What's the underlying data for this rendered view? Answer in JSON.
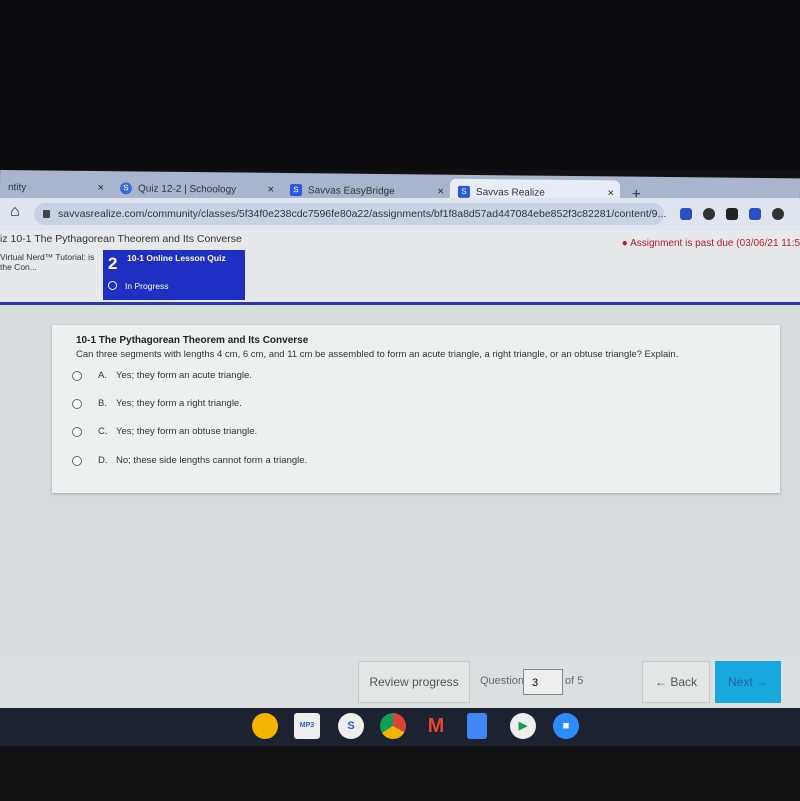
{
  "browser": {
    "tabs": [
      {
        "label": "ntity",
        "active": false
      },
      {
        "label": "Quiz 12-2 | Schoology",
        "active": false
      },
      {
        "label": "Savvas EasyBridge",
        "active": false
      },
      {
        "label": "Savvas Realize",
        "active": true
      }
    ],
    "close_glyph": "×",
    "new_tab_glyph": "+",
    "url": "savvasrealize.com/community/classes/5f34f0e238cdc7596fe80a22/assignments/bf1f8a8d57ad447084ebe852f3c82281/content/9...",
    "home_glyph": "⌂"
  },
  "page": {
    "title": "iz 10-1 The Pythagorean Theorem and Its Converse",
    "past_due": "Assignment is past due (03/06/21 11:5",
    "prev_item": "Virtual Nerd™ Tutorial: is the Con...",
    "current_item": {
      "number": "2",
      "title": "10-1 Online Lesson Quiz",
      "status": "In Progress"
    }
  },
  "question": {
    "title": "10-1 The Pythagorean Theorem and Its Converse",
    "text": "Can three segments with lengths 4 cm, 6 cm, and 11 cm be assembled to form an acute triangle, a right triangle, or an obtuse triangle? Explain.",
    "options": [
      {
        "letter": "A.",
        "text": "Yes; they form an acute triangle."
      },
      {
        "letter": "B.",
        "text": "Yes; they form a right triangle."
      },
      {
        "letter": "C.",
        "text": "Yes; they form an obtuse triangle."
      },
      {
        "letter": "D.",
        "text": "No; these side lengths cannot form a triangle."
      }
    ]
  },
  "footer": {
    "review": "Review progress",
    "question_label": "Question",
    "question_value": "3",
    "of_total": "of 5",
    "back": "← Back",
    "next": "Next →"
  },
  "colors": {
    "accent_blue": "#1f2fc4",
    "next_button": "#17a9de",
    "past_due": "#b3202a"
  },
  "taskbar": [
    "keep",
    "mp3",
    "s",
    "chrome",
    "gmail",
    "docs",
    "play",
    "zoom"
  ]
}
